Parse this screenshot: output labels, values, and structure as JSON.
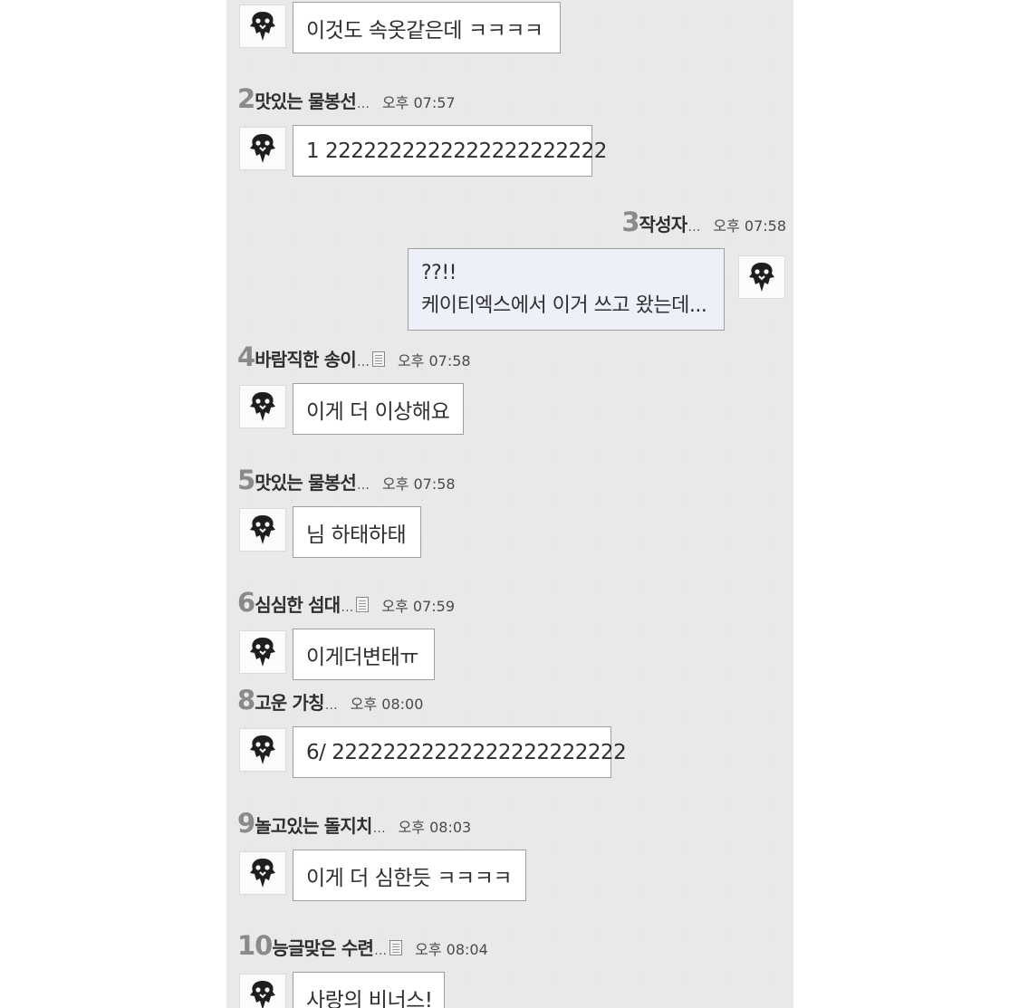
{
  "messages": [
    {
      "num": "",
      "name": "",
      "time": "",
      "text": "이것도 속옷같은데 ㅋㅋㅋㅋ",
      "has_doc": false
    },
    {
      "num": "2",
      "name": "맛있는 물봉선",
      "time": "오후 07:57",
      "text": "1 2222222222222222222222",
      "has_doc": false
    },
    {
      "num": "3",
      "name": "작성자",
      "time": "오후 07:58",
      "line1": "??!!",
      "line2": "케이티엑스에서 이거 쓰고 왔는데...",
      "has_doc": false
    },
    {
      "num": "4",
      "name": "바람직한 송이",
      "time": "오후 07:58",
      "text": "이게 더 이상해요",
      "has_doc": true
    },
    {
      "num": "5",
      "name": "맛있는 물봉선",
      "time": "오후 07:58",
      "text": "님 하태하태",
      "has_doc": false
    },
    {
      "num": "6",
      "name": "심심한 섬대",
      "time": "오후 07:59",
      "text": "이게더변태ㅠ",
      "has_doc": true
    },
    {
      "num": "8",
      "name": "고운 가칭",
      "time": "오후 08:00",
      "text": "6/ 22222222222222222222222",
      "has_doc": false
    },
    {
      "num": "9",
      "name": "놀고있는 돌지치",
      "time": "오후 08:03",
      "text": "이게 더 심한듯 ㅋㅋㅋㅋ",
      "has_doc": false
    },
    {
      "num": "10",
      "name": "능글맞은 수련",
      "time": "오후 08:04",
      "text": "사랑의 비너스!",
      "has_doc": true
    }
  ],
  "ellipsis": "…",
  "icons": {
    "avatar": "default-profile-icon",
    "doc": "memo-icon"
  },
  "colors": {
    "background": "#e9e9e9",
    "bubble": "#ffffff",
    "mine_bubble": "#edeff9",
    "number": "#8a8a8a"
  }
}
